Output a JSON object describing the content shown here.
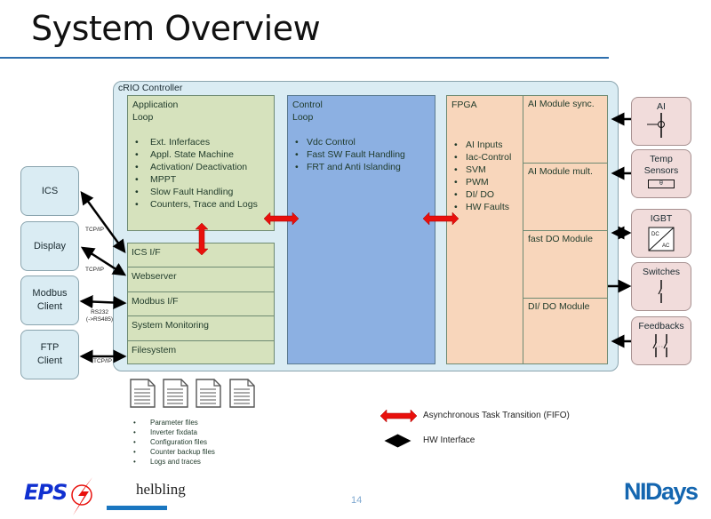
{
  "title": "System Overview",
  "controller": {
    "label": "cRIO Controller",
    "application_loop": {
      "title_line1": "Application",
      "title_line2": "Loop",
      "items": [
        "Ext. Inferfaces",
        "Appl. State Machine",
        "Activation/ Deactivation",
        "MPPT",
        "Slow Fault Handling",
        "Counters, Trace and Logs"
      ]
    },
    "interfaces": [
      "ICS I/F",
      "Webserver",
      "Modbus I/F",
      "System Monitoring",
      "Filesystem"
    ],
    "control_loop": {
      "title_line1": "Control",
      "title_line2": "Loop",
      "items": [
        "Vdc Control",
        "Fast SW Fault Handling",
        "FRT and Anti Islanding"
      ]
    },
    "fpga": {
      "title": "FPGA",
      "items": [
        "AI Inputs",
        "Iac-Control",
        "SVM",
        "PWM",
        "DI/ DO",
        "HW Faults"
      ]
    },
    "modules": [
      "AI Module sync.",
      "AI Module mult.",
      "fast DO Module",
      "DI/ DO Module"
    ]
  },
  "clients": [
    {
      "line1": "ICS",
      "line2": ""
    },
    {
      "line1": "Display",
      "line2": ""
    },
    {
      "line1": "Modbus",
      "line2": "Client"
    },
    {
      "line1": "FTP",
      "line2": "Client"
    }
  ],
  "protocols": {
    "ics": "TCP/IP",
    "display": "TCP/IP",
    "modbus_line1": "RS232",
    "modbus_line2": "(->RS485)",
    "ftp": "TCP/IP"
  },
  "devices": [
    {
      "label": "AI",
      "icon": "analog-input-icon"
    },
    {
      "label": "Temp Sensors",
      "icon": "temperature-sensor-icon",
      "symbol": "θ"
    },
    {
      "label": "IGBT",
      "icon": "dc-ac-converter-icon",
      "dc": "DC",
      "ac": "AC"
    },
    {
      "label": "Switches",
      "icon": "switch-icon"
    },
    {
      "label": "Feedbacks",
      "icon": "feedback-contacts-icon"
    }
  ],
  "files": [
    "Parameter files",
    "Inverter fixdata",
    "Configuration files",
    "Counter backup files",
    "Logs and traces"
  ],
  "legend": {
    "fifo": "Asynchronous Task Transition (FIFO)",
    "hw": "HW Interface"
  },
  "colors": {
    "fifo_arrow": "#e8100c",
    "hw_arrow": "#000000",
    "app_loop": "#d6e2bd",
    "control_loop": "#8cb0e2",
    "fpga": "#f8d6bb",
    "controller": "#daecf3",
    "device": "#f1dcdb",
    "brand_blue": "#1466b0"
  },
  "footer": {
    "eps": "EPS",
    "helbling": "helbling",
    "page": "14",
    "nidays": "NIDays"
  }
}
